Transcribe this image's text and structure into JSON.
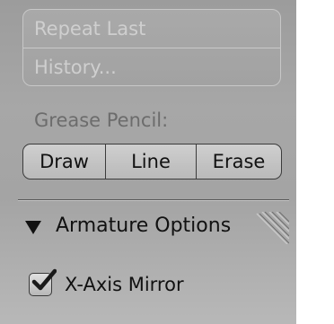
{
  "history": {
    "repeat_last_label": "Repeat Last",
    "history_label": "History..."
  },
  "grease_pencil": {
    "label": "Grease Pencil:",
    "buttons": [
      {
        "label": "Draw"
      },
      {
        "label": "Line"
      },
      {
        "label": "Erase"
      }
    ]
  },
  "armature": {
    "title": "Armature Options",
    "expanded_icon": "triangle-down-icon",
    "grip_icon": "drag-grip-icon",
    "x_axis_mirror": {
      "label": "X-Axis Mirror",
      "checked": true
    }
  }
}
